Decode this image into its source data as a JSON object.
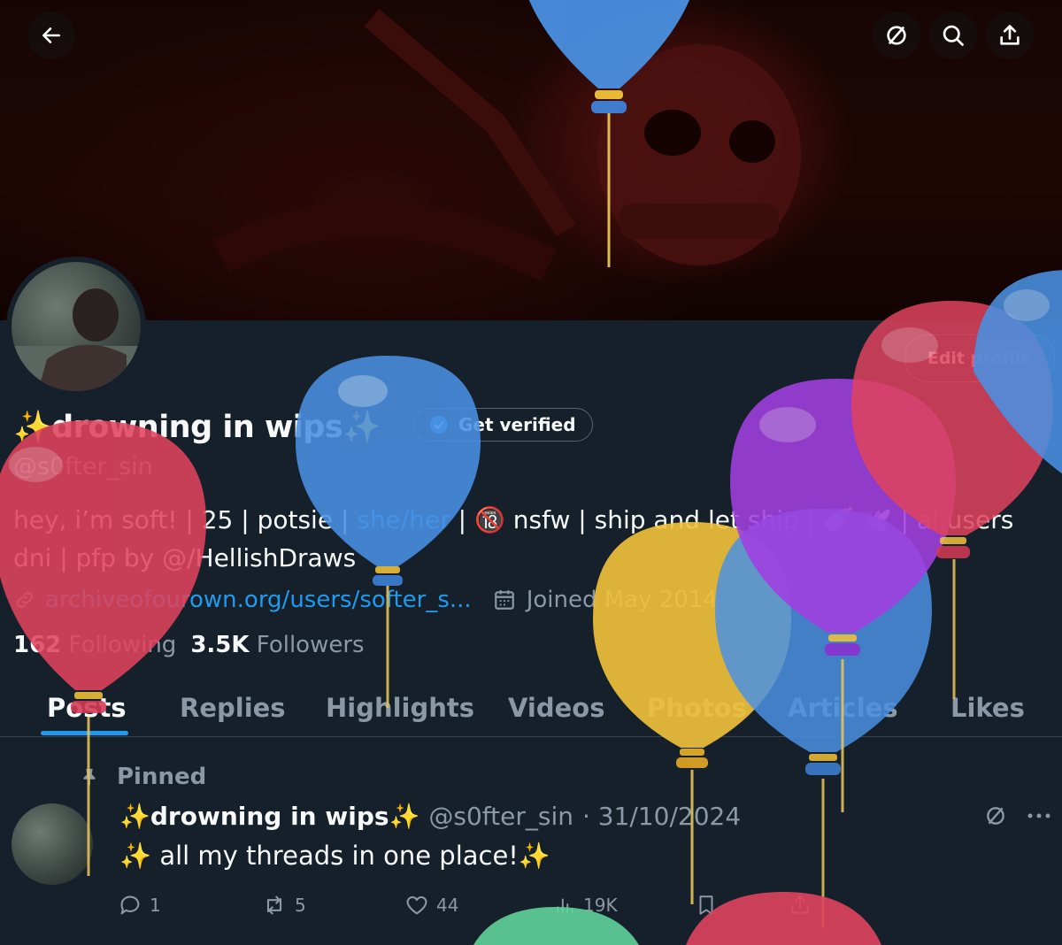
{
  "header": {
    "back_icon": "arrow-left-icon",
    "grok_icon": "slashed-circle-icon",
    "search_icon": "search-icon",
    "share_icon": "upload-icon"
  },
  "profile": {
    "edit_label": "Edit profile",
    "display_name": "✨drowning in wips✨",
    "get_verified": "Get verified",
    "handle": "@s0fter_sin",
    "bio": {
      "part1": "hey, i’m soft! | 25 | potsie | ",
      "pronouns": "she/her",
      "part2": " | 🔞 nsfw | ship and let ship | 🍼 🕊️ | ai users",
      "line2a": "dni | pfp by ",
      "mention": "@/HellishDraws"
    },
    "link": "archiveofourown.org/users/softer_s...",
    "joined": "Joined May 2014",
    "following_count": "162",
    "following_label": "Following",
    "followers_count": "3.5K",
    "followers_label": "Followers"
  },
  "tabs": [
    "Posts",
    "Replies",
    "Highlights",
    "Videos",
    "Photos",
    "Articles",
    "Likes"
  ],
  "active_tab": "Posts",
  "pinned_post": {
    "pinned_label": "Pinned",
    "author_name": "✨drowning in wips✨",
    "author_handle": "@s0fter_sin",
    "date": "· 31/10/2024",
    "text": "✨ all my threads in one place!✨",
    "replies": "1",
    "reposts": "5",
    "likes": "44",
    "views": "19K"
  },
  "colors": {
    "background": "#15202b",
    "accent": "#1d9bf0",
    "muted": "#8b98a5",
    "balloon_red": "#e0435d",
    "balloon_blue": "#4a90e2",
    "balloon_purple": "#a23fe0",
    "balloon_yellow": "#f2c23a",
    "balloon_green": "#5fd39a"
  }
}
